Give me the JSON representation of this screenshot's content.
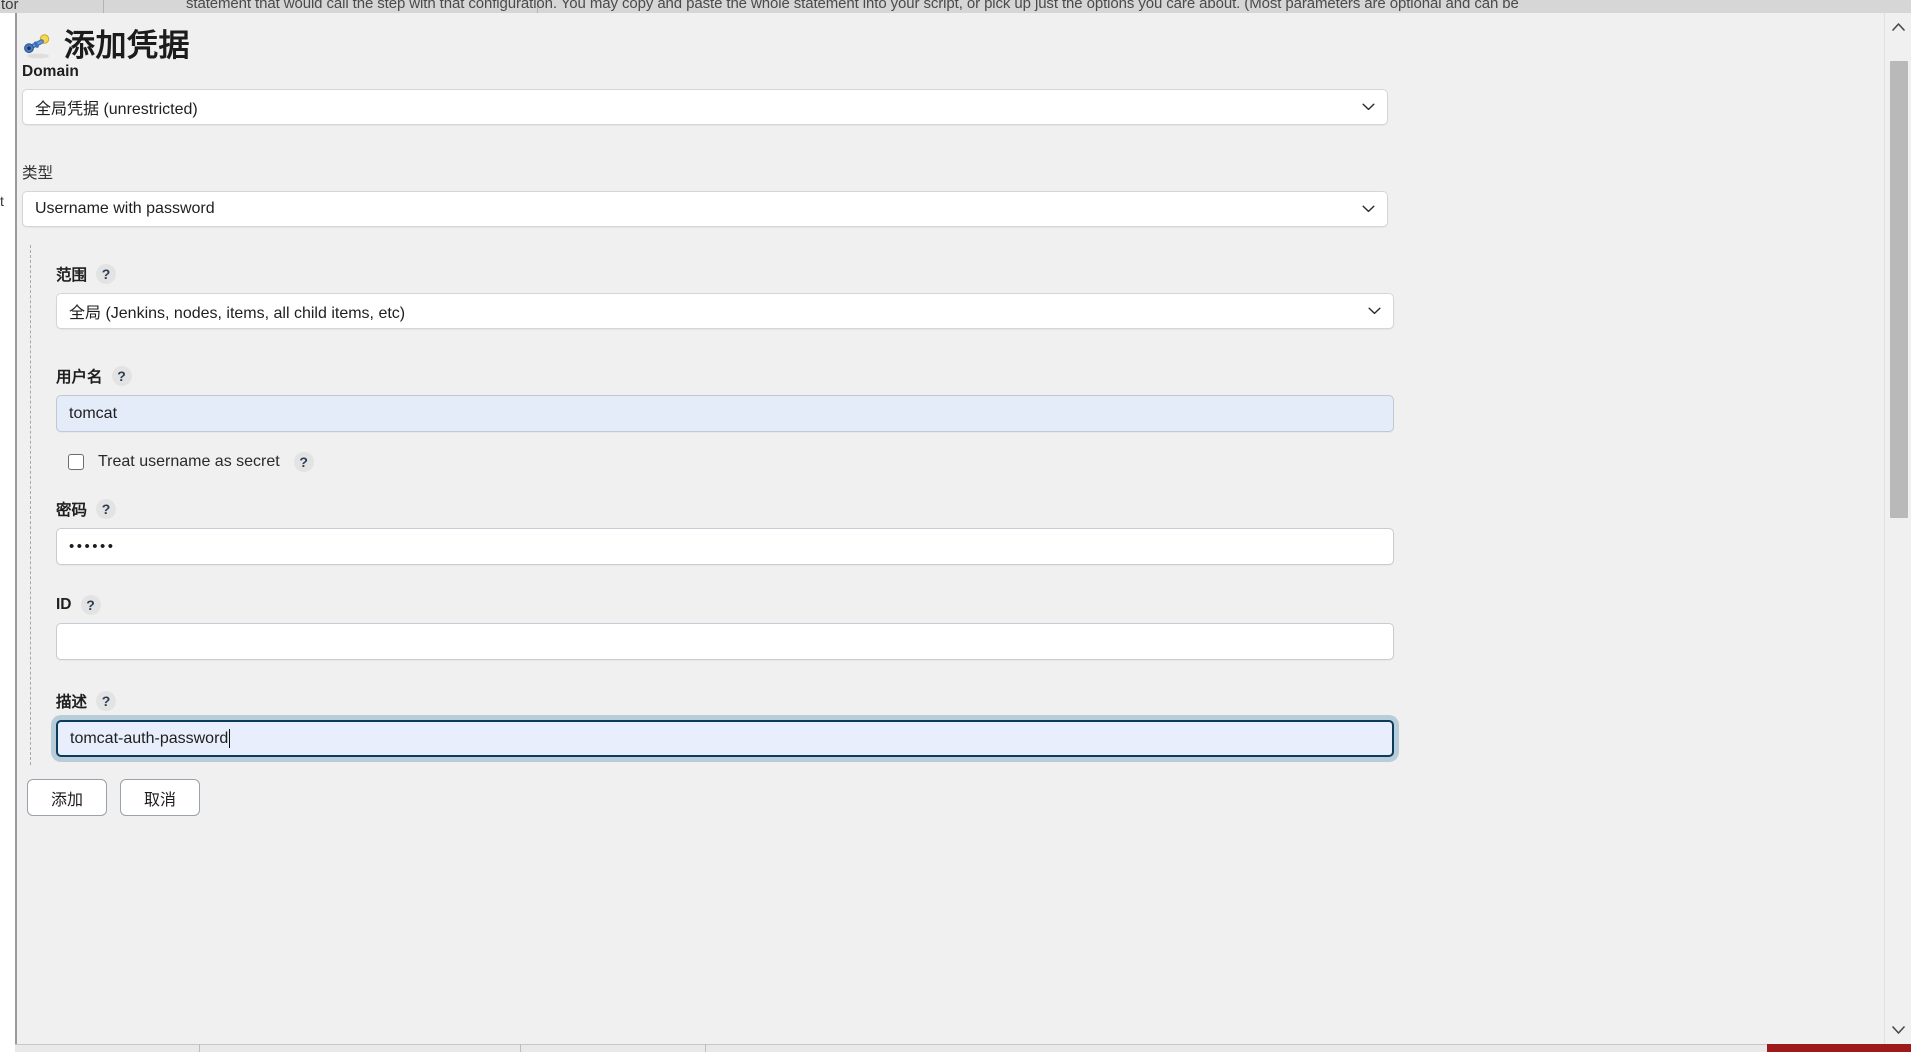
{
  "background": {
    "top_text": "statement that would call the step with that configuration. You may copy and paste the whole statement into your script, or pick up just the options you care about. (Most parameters are optional and can be",
    "left_label": "tor",
    "left_col_label": "t"
  },
  "dialog": {
    "title": "添加凭据",
    "icon": "key-icon",
    "domain": {
      "label": "Domain",
      "selected": "全局凭据 (unrestricted)"
    },
    "type": {
      "label": "类型",
      "selected": "Username with password"
    },
    "scope": {
      "label": "范围",
      "help": "?",
      "selected": "全局 (Jenkins, nodes, items, all child items, etc)"
    },
    "username": {
      "label": "用户名",
      "help": "?",
      "value": "tomcat",
      "placeholder": ""
    },
    "secret_checkbox": {
      "label": "Treat username as secret",
      "help": "?",
      "checked": false
    },
    "password": {
      "label": "密码",
      "help": "?",
      "value": "••••••",
      "placeholder": ""
    },
    "id": {
      "label": "ID",
      "help": "?",
      "value": "",
      "placeholder": ""
    },
    "description": {
      "label": "描述",
      "help": "?",
      "value": "tomcat-auth-password",
      "placeholder": "",
      "focused": true
    },
    "buttons": {
      "add": "添加",
      "cancel": "取消"
    }
  },
  "scrollbar": {
    "up_arrow": "▲",
    "down_arrow": "▼"
  },
  "colors": {
    "dialog_bg": "#f0f0f0",
    "autofill_blue": "#e4ecf9",
    "focus_border": "#0b3c5d",
    "accent_red": "#9e1919",
    "scroll_thumb": "#b9b9b9"
  }
}
